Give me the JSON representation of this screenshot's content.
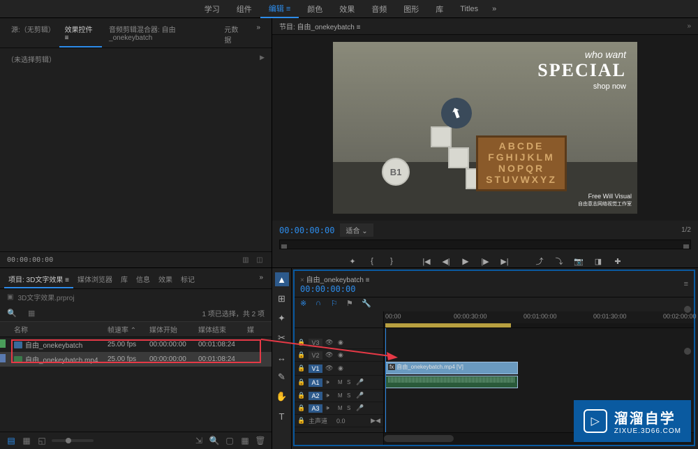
{
  "topbar": {
    "items": [
      "学习",
      "组件",
      "编辑",
      "颜色",
      "效果",
      "音频",
      "图形",
      "库",
      "Titles"
    ],
    "active_index": 2
  },
  "source": {
    "tabs": {
      "no_clip": "源:（无剪辑）",
      "effect_controls": "效果控件",
      "audio_mixer": "音频剪辑混合器: 自由_onekeybatch",
      "metadata": "元数据"
    },
    "body_text": "（未选择剪辑）",
    "timecode": "00:00:00:00"
  },
  "project": {
    "tabs": {
      "project": "项目: 3D文字效果",
      "media_browser": "媒体浏览器",
      "library": "库",
      "info": "信息",
      "effects": "效果",
      "markers": "标记"
    },
    "filename": "3D文字效果.prproj",
    "count_label": "1 项已选择，共 2 项",
    "columns": {
      "name": "名称",
      "fps": "帧速率",
      "start": "媒体开始",
      "end": "媒体结束",
      "media": "媒"
    },
    "rows": [
      {
        "color": "g",
        "icon": "seq",
        "name": "自由_onekeybatch",
        "fps": "25.00 fps",
        "start": "00:00:00:00",
        "end": "00:01:08:24"
      },
      {
        "color": "b",
        "icon": "clip",
        "name": "自由_onekeybatch.mp4",
        "fps": "25.00 fps",
        "start": "00:00:00:00",
        "end": "00:01:08:24"
      }
    ]
  },
  "program": {
    "header": "节目: 自由_onekeybatch",
    "timecode": "00:00:00:00",
    "fit_label": "适合",
    "page": "1/2",
    "preview": {
      "who_want": "who   want",
      "special": "SPECIAL",
      "shop_now": "shop now",
      "b1": "B1",
      "alphabet": "ABCDE\nFGHIJKLM\nNOPQR\nSTUVWXYZ",
      "watermark_title": "Free Will Visual",
      "watermark_sub": "自由意志网络视觉工作室"
    }
  },
  "timeline": {
    "seq_name": "自由_onekeybatch",
    "timecode": "00:00:00:00",
    "ruler_marks": [
      "00:00",
      "00:00:30:00",
      "00:01:00:00",
      "00:01:30:00",
      "00:02:00:00"
    ],
    "tracks": {
      "v3": "V3",
      "v2": "V2",
      "v1": "V1",
      "a1": "A1",
      "a2": "A2",
      "a3": "A3",
      "master": "主声道",
      "master_val": "0.0"
    },
    "clip_v1": "自由_onekeybatch.mp4 [V]",
    "ms": {
      "m": "M",
      "s": "S"
    }
  },
  "watermark": {
    "cn": "溜溜自学",
    "url": "ZIXUE.3D66.COM"
  }
}
